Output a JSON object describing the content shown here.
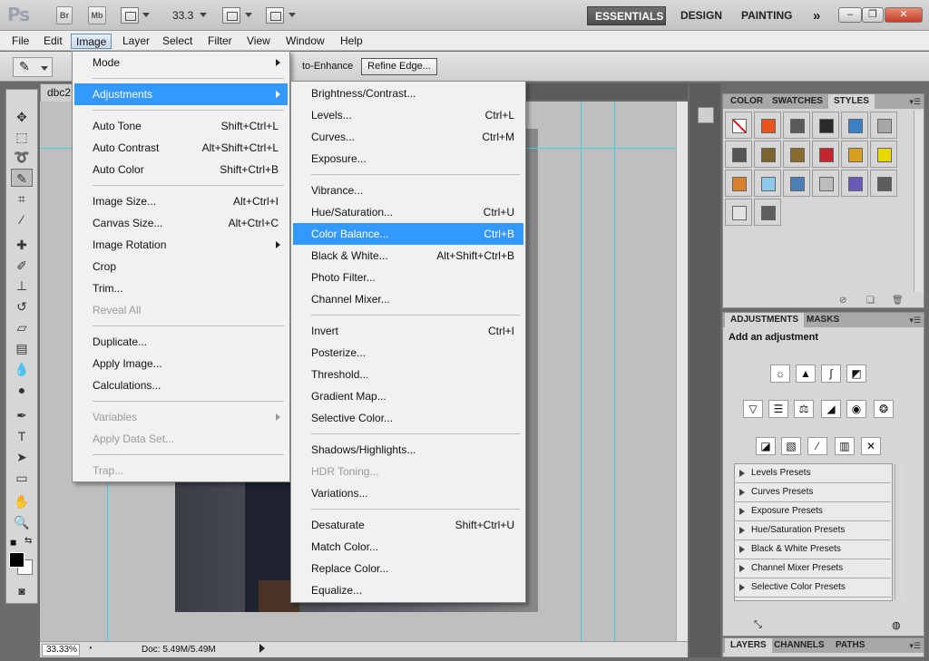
{
  "app": {
    "logo": "Ps",
    "bridge_label": "Br",
    "minibridge_label": "Mb",
    "zoom": "33.3",
    "workspaces": [
      "ESSENTIALS",
      "DESIGN",
      "PAINTING"
    ],
    "more": "»"
  },
  "menubar": [
    "File",
    "Edit",
    "Image",
    "Layer",
    "Select",
    "Filter",
    "View",
    "Window",
    "Help"
  ],
  "options": {
    "auto_enhance": "to-Enhance",
    "refine_edge": "Refine Edge..."
  },
  "document": {
    "tab": "dbc2",
    "zoom": "33.33%",
    "doc_info": "Doc: 5.49M/5.49M"
  },
  "image_menu": [
    {
      "label": "Mode",
      "submenu": true
    },
    {
      "sep": true
    },
    {
      "label": "Adjustments",
      "submenu": true,
      "highlight": true
    },
    {
      "sep": true
    },
    {
      "label": "Auto Tone",
      "shortcut": "Shift+Ctrl+L"
    },
    {
      "label": "Auto Contrast",
      "shortcut": "Alt+Shift+Ctrl+L"
    },
    {
      "label": "Auto Color",
      "shortcut": "Shift+Ctrl+B"
    },
    {
      "sep": true
    },
    {
      "label": "Image Size...",
      "shortcut": "Alt+Ctrl+I"
    },
    {
      "label": "Canvas Size...",
      "shortcut": "Alt+Ctrl+C"
    },
    {
      "label": "Image Rotation",
      "submenu": true
    },
    {
      "label": "Crop"
    },
    {
      "label": "Trim..."
    },
    {
      "label": "Reveal All",
      "disabled": true
    },
    {
      "sep": true
    },
    {
      "label": "Duplicate..."
    },
    {
      "label": "Apply Image..."
    },
    {
      "label": "Calculations..."
    },
    {
      "sep": true
    },
    {
      "label": "Variables",
      "submenu": true,
      "disabled": true
    },
    {
      "label": "Apply Data Set...",
      "disabled": true
    },
    {
      "sep": true
    },
    {
      "label": "Trap...",
      "disabled": true
    }
  ],
  "adjustments_menu": [
    {
      "label": "Brightness/Contrast..."
    },
    {
      "label": "Levels...",
      "shortcut": "Ctrl+L"
    },
    {
      "label": "Curves...",
      "shortcut": "Ctrl+M"
    },
    {
      "label": "Exposure..."
    },
    {
      "sep": true
    },
    {
      "label": "Vibrance..."
    },
    {
      "label": "Hue/Saturation...",
      "shortcut": "Ctrl+U"
    },
    {
      "label": "Color Balance...",
      "shortcut": "Ctrl+B",
      "highlight": true
    },
    {
      "label": "Black & White...",
      "shortcut": "Alt+Shift+Ctrl+B"
    },
    {
      "label": "Photo Filter..."
    },
    {
      "label": "Channel Mixer..."
    },
    {
      "sep": true
    },
    {
      "label": "Invert",
      "shortcut": "Ctrl+I"
    },
    {
      "label": "Posterize..."
    },
    {
      "label": "Threshold..."
    },
    {
      "label": "Gradient Map..."
    },
    {
      "label": "Selective Color..."
    },
    {
      "sep": true
    },
    {
      "label": "Shadows/Highlights..."
    },
    {
      "label": "HDR Toning...",
      "disabled": true
    },
    {
      "label": "Variations..."
    },
    {
      "sep": true
    },
    {
      "label": "Desaturate",
      "shortcut": "Shift+Ctrl+U"
    },
    {
      "label": "Match Color..."
    },
    {
      "label": "Replace Color..."
    },
    {
      "label": "Equalize..."
    }
  ],
  "styles_panel": {
    "tabs": [
      "COLOR",
      "SWATCHES",
      "STYLES"
    ],
    "swatch_colors": [
      "#ffffff",
      "#e8541c",
      "#5b5b5b",
      "#2b2b2b",
      "#3d7fc4",
      "#a7a7a7",
      "#555555",
      "#7a6431",
      "#8a6b2e",
      "#c4262d",
      "#d8a020",
      "#e8d800",
      "#d9802f",
      "#8ec8ea",
      "#4d7fb6",
      "#bdbdbd",
      "#6a5ab8",
      "#5c5c5c",
      "#e2e2e2",
      "#5e5e5e"
    ]
  },
  "adjustments_panel": {
    "tabs": [
      "ADJUSTMENTS",
      "MASKS"
    ],
    "title": "Add an adjustment",
    "presets": [
      "Levels Presets",
      "Curves Presets",
      "Exposure Presets",
      "Hue/Saturation Presets",
      "Black & White Presets",
      "Channel Mixer Presets",
      "Selective Color Presets"
    ]
  },
  "layers_panel": {
    "tabs": [
      "LAYERS",
      "CHANNELS",
      "PATHS"
    ]
  }
}
